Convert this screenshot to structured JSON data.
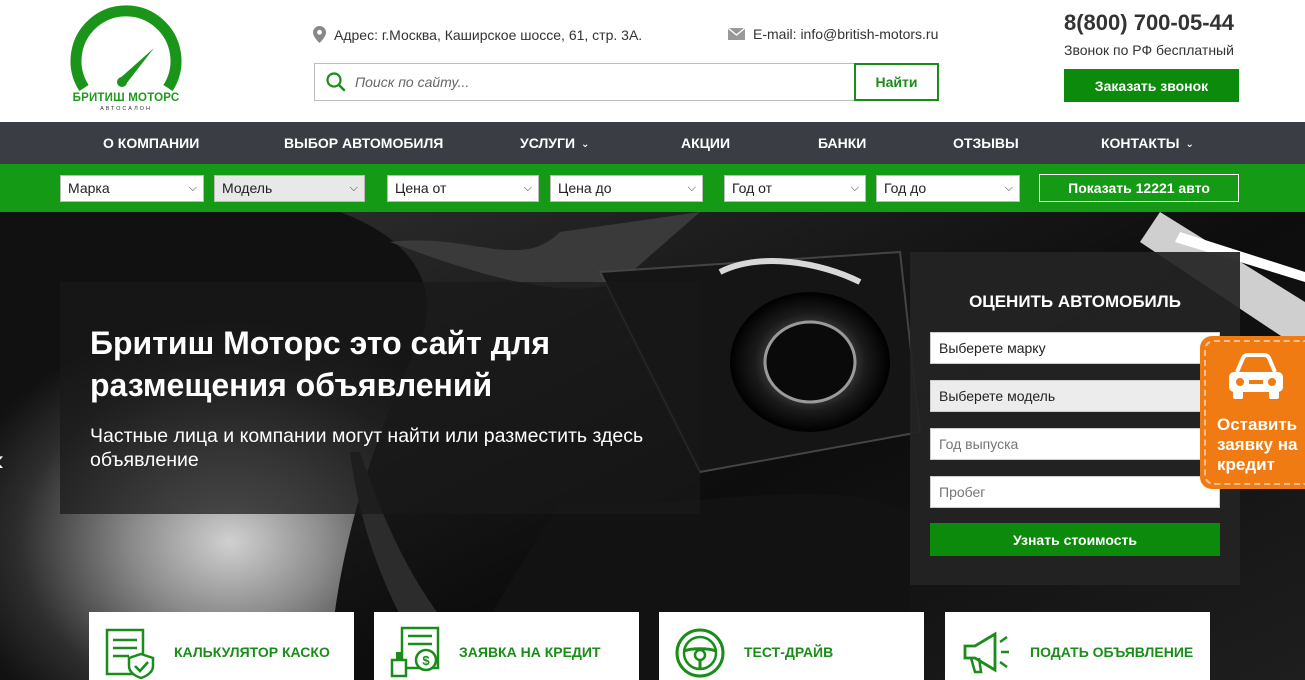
{
  "logo": {
    "name": "БРИТИШ МОТОРС",
    "subtitle": "АВТОСАЛОН"
  },
  "header": {
    "address": "Адрес: г.Москва, Каширское шоссе, 61, стр. 3А.",
    "email": "E-mail: info@british-motors.ru",
    "phone": "8(800) 700-05-44",
    "phone_note": "Звонок по РФ бесплатный",
    "callback_label": "Заказать звонок"
  },
  "search": {
    "placeholder": "Поиск по сайту...",
    "button_label": "Найти"
  },
  "nav": {
    "items": [
      {
        "label": "О КОМПАНИИ",
        "dropdown": false
      },
      {
        "label": "ВЫБОР АВТОМОБИЛЯ",
        "dropdown": false
      },
      {
        "label": "УСЛУГИ",
        "dropdown": true
      },
      {
        "label": "АКЦИИ",
        "dropdown": false
      },
      {
        "label": "БАНКИ",
        "dropdown": false
      },
      {
        "label": "ОТЗЫВЫ",
        "dropdown": false
      },
      {
        "label": "КОНТАКТЫ",
        "dropdown": true
      }
    ]
  },
  "filter": {
    "make": "Марка",
    "model": "Модель",
    "price_from": "Цена от",
    "price_to": "Цена до",
    "year_from": "Год от",
    "year_to": "Год до",
    "show_button": "Показать 12221 авто"
  },
  "hero": {
    "title": "Бритиш Моторс это сайт для размещения объявлений",
    "subtitle": "Частные лица и компании могут найти или разместить здесь объявление"
  },
  "appraise": {
    "title": "ОЦЕНИТЬ АВТОМОБИЛЬ",
    "brand": "Выберете марку",
    "model": "Выберете модель",
    "year_placeholder": "Год выпуска",
    "mileage_placeholder": "Пробег",
    "button_label": "Узнать стоимость"
  },
  "credit_tab": {
    "label": "Оставить заявку на кредит"
  },
  "cards": [
    {
      "label": "КАЛЬКУЛЯТОР КАСКО",
      "icon": "insurance-document-icon"
    },
    {
      "label": "ЗАЯВКА НА КРЕДИТ",
      "icon": "credit-application-icon"
    },
    {
      "label": "ТЕСТ-ДРАЙВ",
      "icon": "steering-wheel-icon"
    },
    {
      "label": "ПОДАТЬ ОБЪЯВЛЕНИЕ",
      "icon": "megaphone-icon"
    }
  ],
  "colors": {
    "brand_green": "#0b8a0b",
    "nav_bg": "#3a3d44",
    "filter_bg": "#159a15",
    "credit_orange": "#f07b12"
  }
}
